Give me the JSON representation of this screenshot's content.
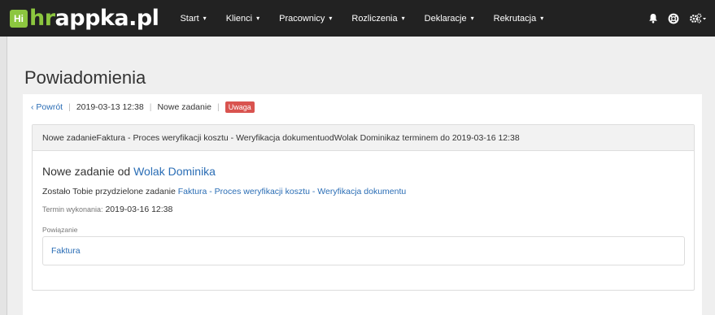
{
  "brand": {
    "badge": "Hi",
    "name_accent": "hr",
    "name_rest": "appka.pl"
  },
  "nav": {
    "items": [
      {
        "label": "Start"
      },
      {
        "label": "Klienci"
      },
      {
        "label": "Pracownicy"
      },
      {
        "label": "Rozliczenia"
      },
      {
        "label": "Deklaracje"
      },
      {
        "label": "Rekrutacja"
      }
    ],
    "caret": "▾"
  },
  "page": {
    "title": "Powiadomienia"
  },
  "breadcrumb": {
    "back": "‹ Powrót",
    "separator": "|",
    "date": "2019-03-13 12:38",
    "type": "Nowe zadanie",
    "badge": "Uwaga"
  },
  "notification": {
    "header": {
      "prefix": "Nowe zadanie ",
      "task": "Faktura - Proces weryfikacji kosztu - Weryfikacja dokumentu",
      "mid": " od ",
      "person": "Wolak Dominika",
      "suffix": " z terminem do 2019-03-16 12:38"
    },
    "title_prefix": "Nowe zadanie od ",
    "title_person": "Wolak Dominika",
    "assigned_prefix": "Zostało Tobie przydzielone zadanie ",
    "assigned_task": "Faktura - Proces weryfikacji kosztu - Weryfikacja dokumentu",
    "deadline_label": "Termin wykonania:",
    "deadline_value": "2019-03-16 12:38",
    "related_label": "Powiązanie",
    "related_link": "Faktura"
  },
  "colors": {
    "brand_green": "#8cc63f",
    "navbar": "#222222",
    "link": "#2a6db5",
    "warning": "#d9534f"
  },
  "icons": [
    "bell-icon",
    "lifebuoy-icon",
    "gears-icon"
  ]
}
